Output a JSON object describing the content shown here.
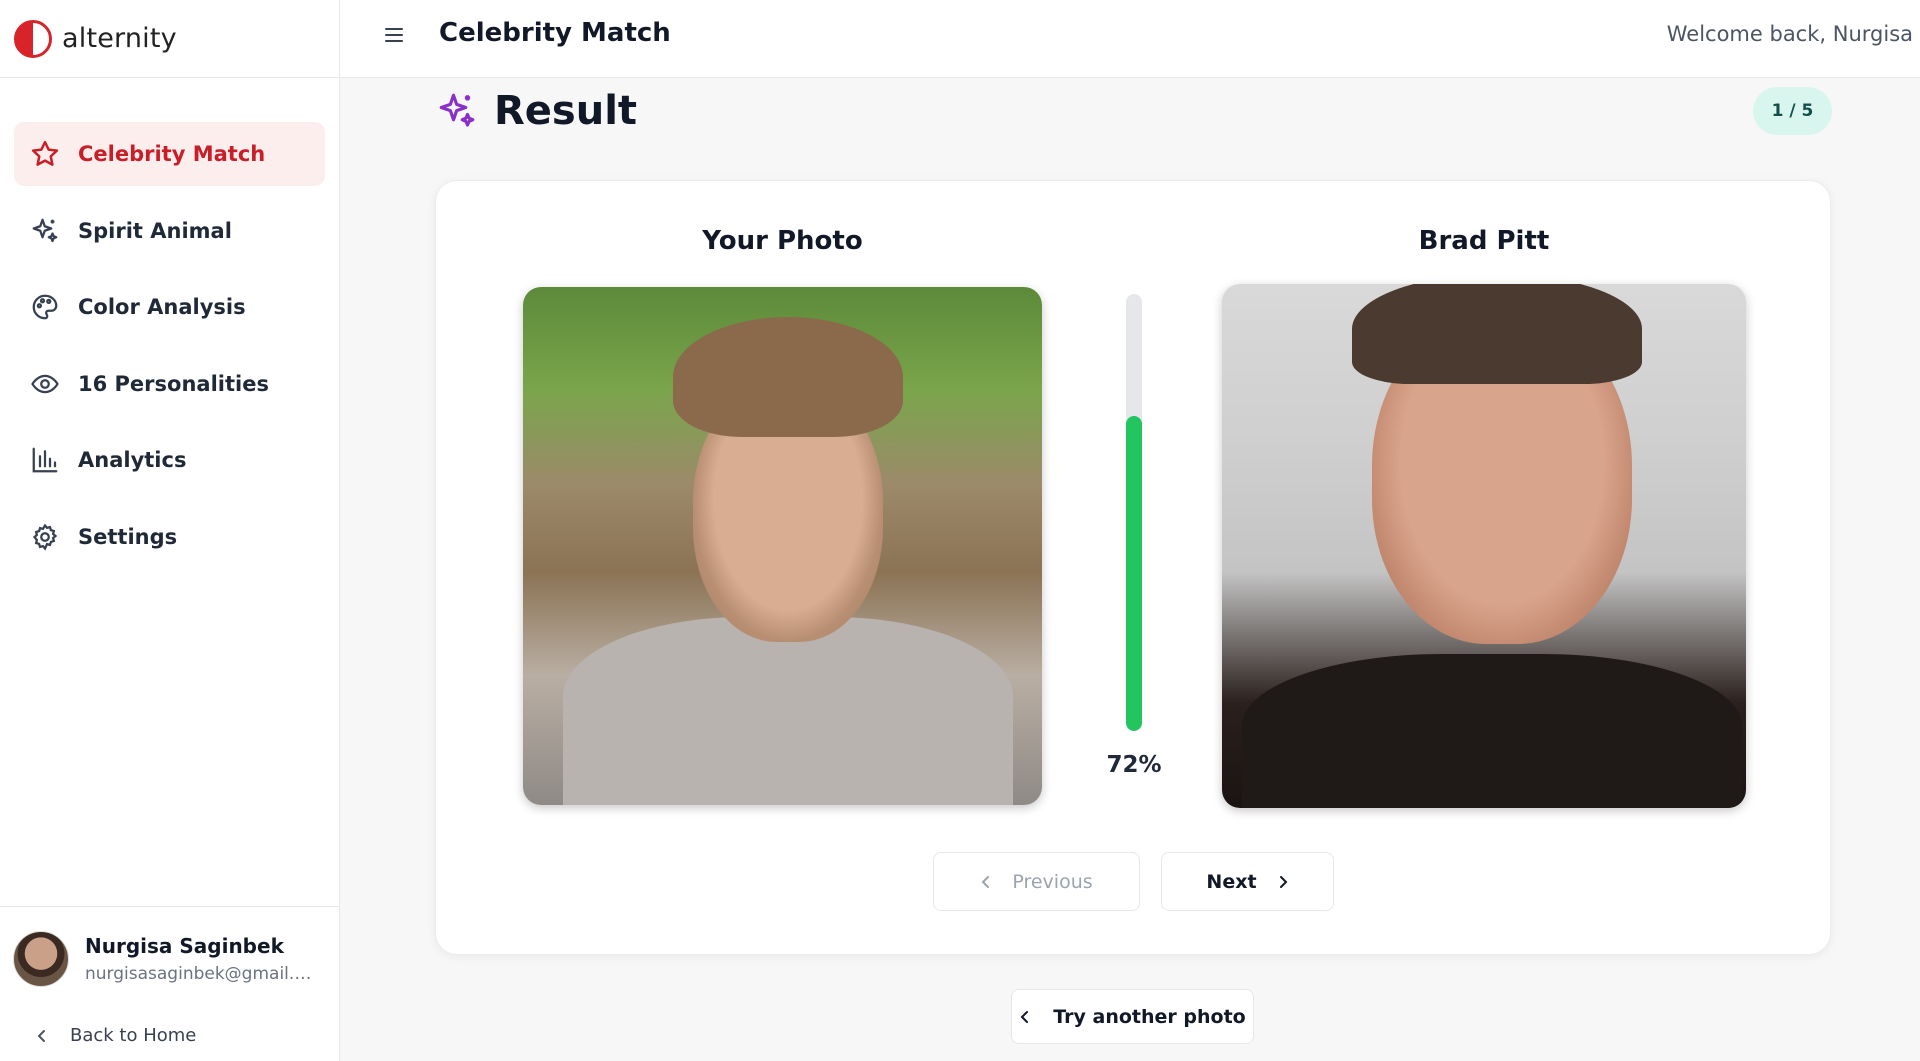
{
  "brand": {
    "name": "alternity"
  },
  "topbar": {
    "title": "Celebrity Match",
    "welcome": "Welcome back, Nurgisa"
  },
  "sidebar": {
    "items": [
      {
        "label": "Celebrity Match",
        "icon": "star-icon",
        "active": true
      },
      {
        "label": "Spirit Animal",
        "icon": "sparkles-icon",
        "active": false
      },
      {
        "label": "Color Analysis",
        "icon": "palette-icon",
        "active": false
      },
      {
        "label": "16 Personalities",
        "icon": "eye-icon",
        "active": false
      },
      {
        "label": "Analytics",
        "icon": "bar-chart-icon",
        "active": false
      },
      {
        "label": "Settings",
        "icon": "gear-icon",
        "active": false
      }
    ],
    "user": {
      "name": "Nurgisa Saginbek",
      "email": "nurgisasaginbek@gmail.c..."
    },
    "back_label": "Back to Home"
  },
  "result": {
    "title": "Result",
    "counter": "1 / 5",
    "your_photo_label": "Your Photo",
    "celebrity_name": "Brad Pitt",
    "match_percent_text": "72%",
    "match_fraction": 0.72,
    "previous_label": "Previous",
    "next_label": "Next",
    "try_another_label": "Try another photo"
  },
  "colors": {
    "accent": "#c81e28",
    "active_bg": "#fdeeee",
    "meter": "#22c55e",
    "badge_bg": "#d8f6ee",
    "sparkle": "#8b2fc9"
  }
}
